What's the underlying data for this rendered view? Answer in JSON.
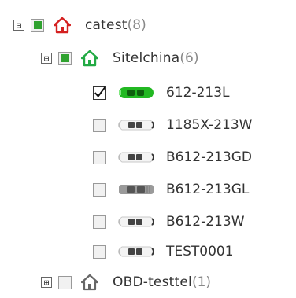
{
  "tree": {
    "root": {
      "name": "catest",
      "count": "(8)",
      "toggle": "⊟",
      "home_color": "#d42020"
    },
    "group": {
      "name": "Sitelchina",
      "count": "(6)",
      "toggle": "⊟",
      "home_color": "#22aa44"
    },
    "vehicles": [
      {
        "label": "612-213L",
        "checked": true,
        "status": "online"
      },
      {
        "label": "1185X-213W",
        "checked": false,
        "status": "offline"
      },
      {
        "label": "B612-213GD",
        "checked": false,
        "status": "offline"
      },
      {
        "label": "B612-213GL",
        "checked": false,
        "status": "inactive"
      },
      {
        "label": "B612-213W",
        "checked": false,
        "status": "offline"
      },
      {
        "label": "TEST0001",
        "checked": false,
        "status": "offline"
      }
    ],
    "other": {
      "name": "OBD-testtel",
      "count": "(1)",
      "toggle": "⊞",
      "home_color": "#666666"
    }
  },
  "colors": {
    "partial_check": "#2fa22f",
    "online_car": "#22b822"
  }
}
